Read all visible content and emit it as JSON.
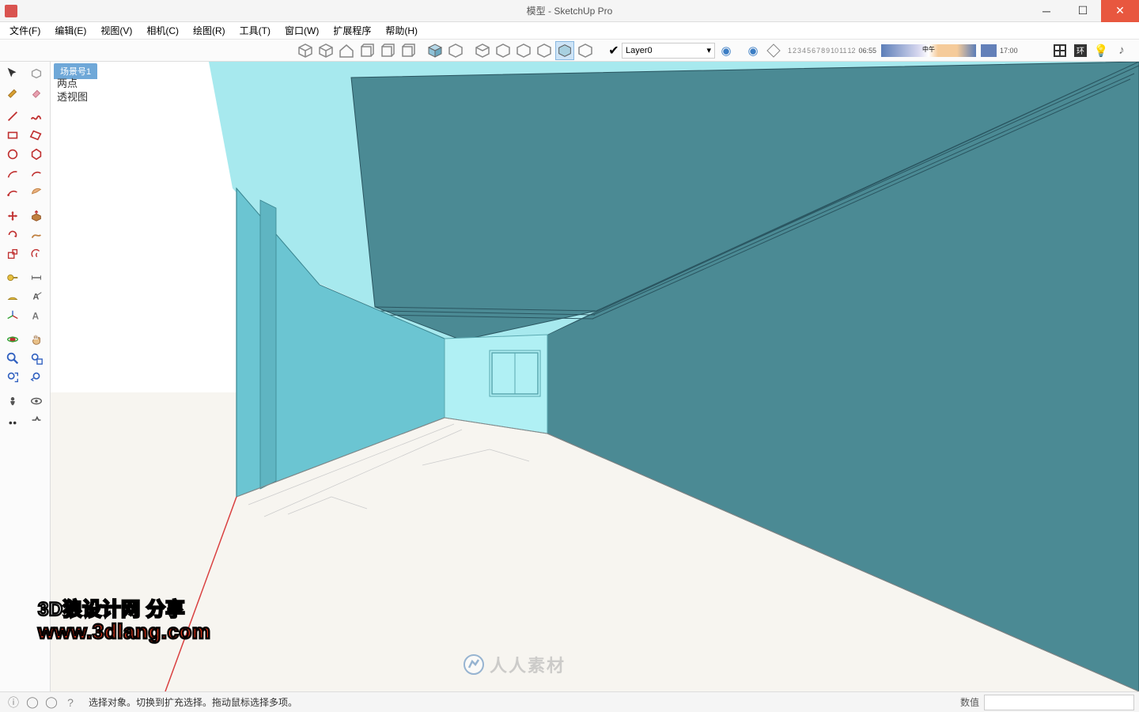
{
  "title": "模型 - SketchUp Pro",
  "menu": [
    "文件(F)",
    "编辑(E)",
    "视图(V)",
    "相机(C)",
    "绘图(R)",
    "工具(T)",
    "窗口(W)",
    "扩展程序",
    "帮助(H)"
  ],
  "layer": "Layer0",
  "shadow_numbers": [
    "1",
    "2",
    "3",
    "4",
    "5",
    "6",
    "7",
    "8",
    "9",
    "10",
    "11",
    "12"
  ],
  "time_start": "06:55",
  "time_mid": "中午",
  "time_end": "17:00",
  "scene_tab": "场景号1",
  "view_label_1": "两点",
  "view_label_2": "透视图",
  "status_text": "选择对象。切换到扩充选择。拖动鼠标选择多项。",
  "status_value_label": "数值",
  "watermark": {
    "line1": "3D狼设计网 分享",
    "line2": "www.3dlang.com",
    "rr": "人人素材"
  }
}
